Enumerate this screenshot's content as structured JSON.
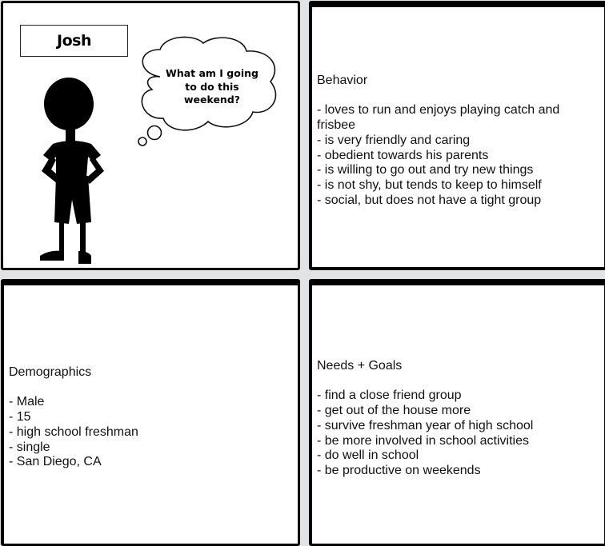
{
  "character": {
    "name": "Josh",
    "thought": "What am I going to do this weekend?"
  },
  "behavior": {
    "heading": "Behavior",
    "items": [
      "- loves to run and enjoys playing catch and frisbee",
      "- is very friendly and caring",
      "- obedient towards his parents",
      "- is willing to go out and try new things",
      "- is not shy, but tends to keep to himself",
      "- social, but does not have a tight group"
    ]
  },
  "demographics": {
    "heading": "Demographics",
    "items": [
      "- Male",
      "- 15",
      "- high school freshman",
      "- single",
      "- San Diego, CA"
    ]
  },
  "needs_goals": {
    "heading": "Needs + Goals",
    "items": [
      "- find a close friend group",
      "- get out of the house more",
      "- survive freshman year of high school",
      "- be more involved in school activities",
      "- do well in school",
      "- be productive on weekends"
    ]
  }
}
